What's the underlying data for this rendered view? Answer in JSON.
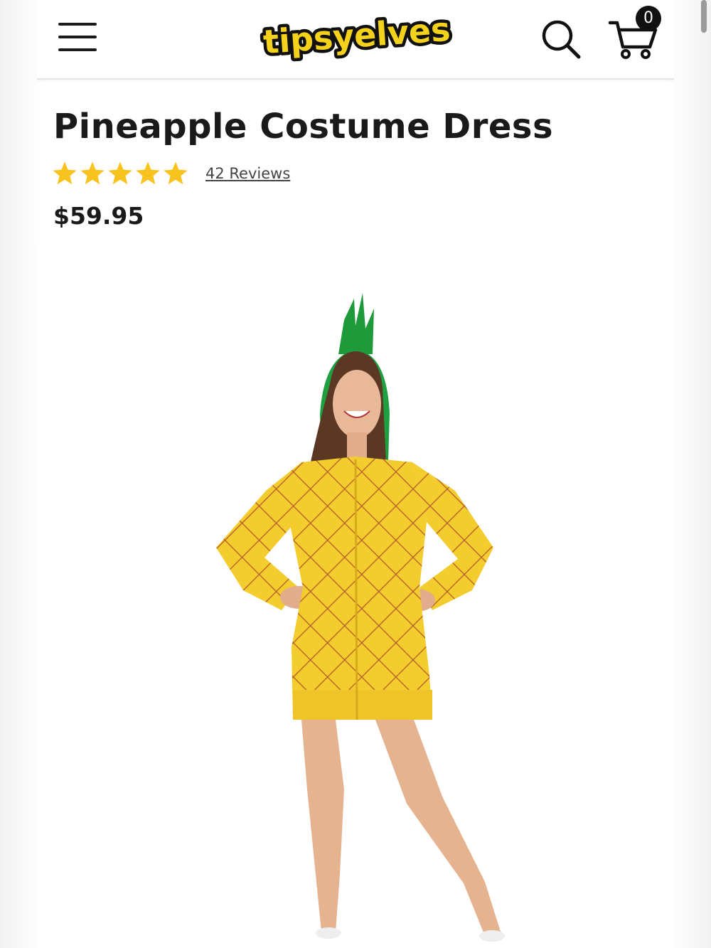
{
  "header": {
    "logo_text": "tipsyelves",
    "cart_count": "0"
  },
  "product": {
    "title": "Pineapple Costume Dress",
    "rating": 5,
    "reviews_label": "42 Reviews",
    "price": "$59.95"
  },
  "colors": {
    "star": "#f9c31f",
    "logo_yellow": "#f4d21c",
    "logo_green": "#3aa53a",
    "dress_yellow": "#f2cd2d",
    "leaf_green": "#1e9a3a"
  },
  "icons": [
    "hamburger-menu-icon",
    "search-icon",
    "cart-icon",
    "star-icon"
  ]
}
